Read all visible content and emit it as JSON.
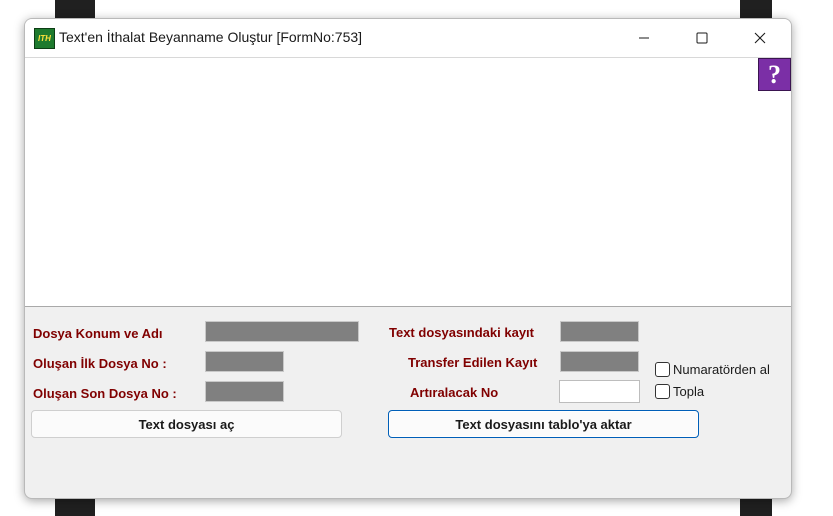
{
  "window": {
    "title": "Text'en İthalat Beyanname Oluştur [FormNo:753]",
    "app_icon_text": "ITH",
    "help_glyph": "?"
  },
  "form": {
    "dosya_konum_label": "Dosya Konum ve Adı",
    "ilk_dosya_label": "Oluşan İlk Dosya No   :",
    "son_dosya_label": "Oluşan Son Dosya No :",
    "kayit_label": "Text dosyasındaki kayıt",
    "transfer_label": "Transfer Edilen Kayıt",
    "artirilacak_label": "Artıralacak No",
    "artirilacak_value": "",
    "numaratorden_label": "Numaratörden al",
    "topla_label": "Topla",
    "numaratorden_checked": false,
    "topla_checked": false
  },
  "buttons": {
    "open_label": "Text dosyası aç",
    "transfer_label": "Text dosyasını tablo'ya aktar"
  },
  "colors": {
    "label_text": "#800000",
    "readonly_field": "#808080",
    "help_button": "#7b2fa6",
    "focus_border": "#005fb8"
  }
}
